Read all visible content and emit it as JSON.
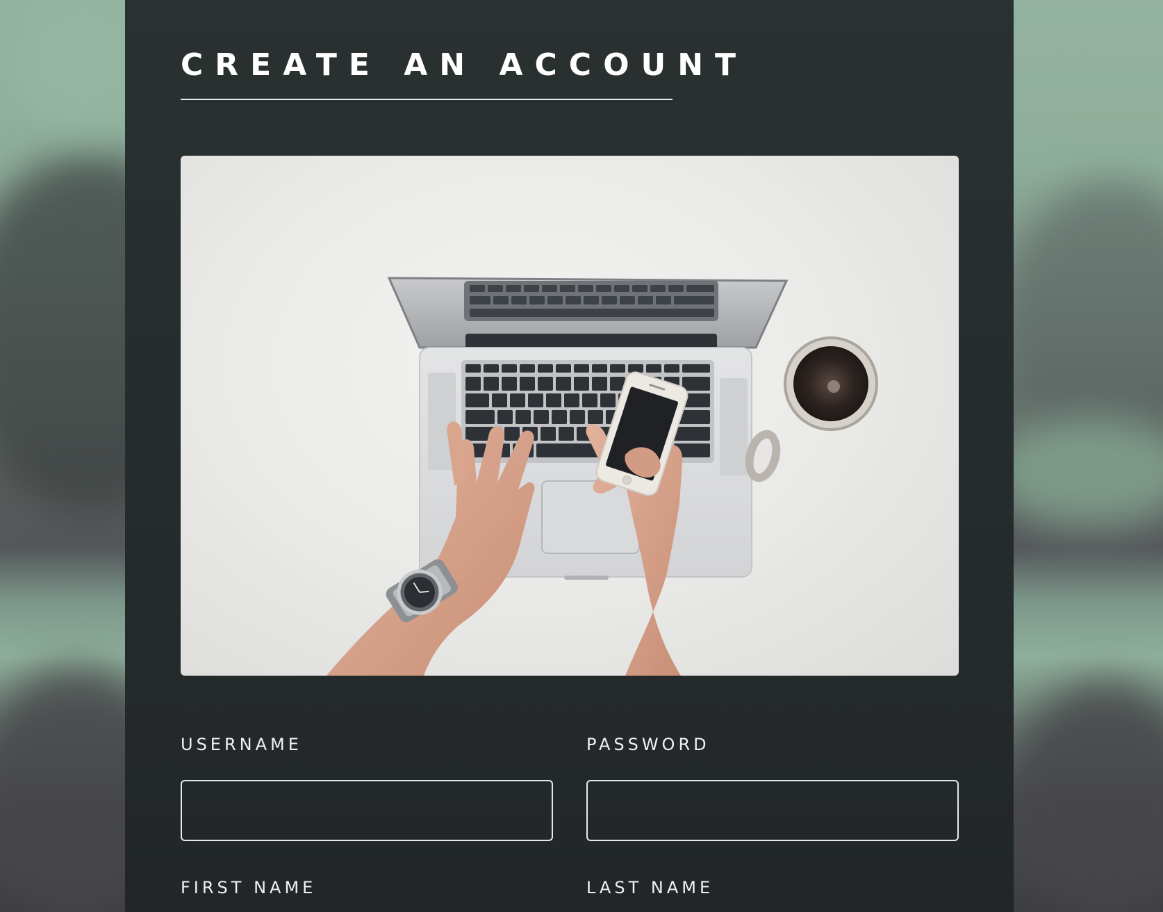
{
  "page": {
    "title": "CREATE AN ACCOUNT"
  },
  "hero_image": {
    "alt": "Hands typing on a laptop keyboard while holding a smartphone, next to a cup of coffee on a white desk"
  },
  "form": {
    "username": {
      "label": "USERNAME",
      "value": "",
      "placeholder": ""
    },
    "password": {
      "label": "PASSWORD",
      "value": "",
      "placeholder": ""
    },
    "first_name": {
      "label": "FIRST NAME"
    },
    "last_name": {
      "label": "LAST NAME"
    }
  },
  "colors": {
    "panel_background": "#272d2e",
    "backdrop_accent": "#8fb09c",
    "text": "#ffffff",
    "input_border": "#e6ebec"
  }
}
